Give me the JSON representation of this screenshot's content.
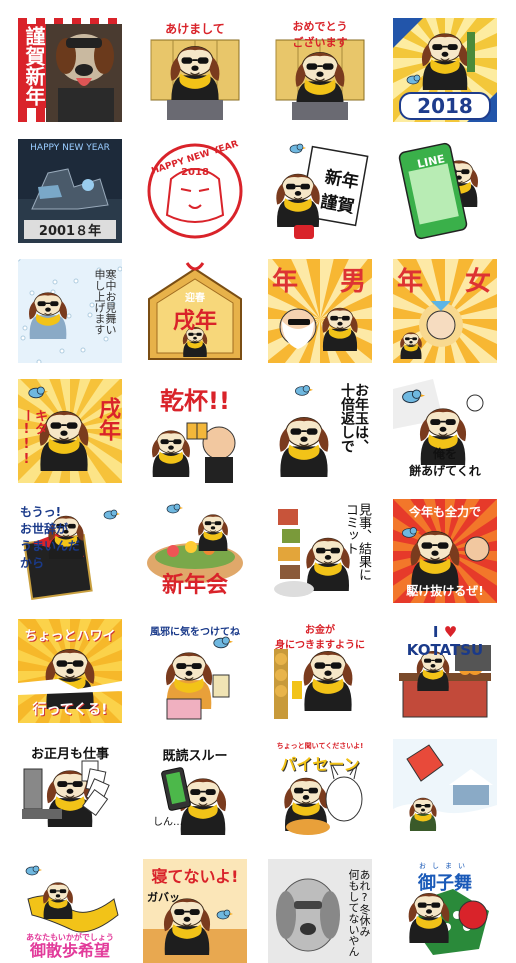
{
  "palette": {
    "fur_brown": "#7a3b1e",
    "fur_cream": "#f6e7c8",
    "ruff_yellow": "#f2c318",
    "suit_black": "#1e1e1e",
    "bird_blue": "#6fb8e0",
    "red": "#d9232a",
    "gold": "#f0b52c"
  },
  "stickers": [
    {
      "id": 1,
      "text": "謹賀新年",
      "icon": "realistic-dog-icon"
    },
    {
      "id": 2,
      "text": "あけまして",
      "icon": "dog-bowing-icon"
    },
    {
      "id": 3,
      "text": "おめでとう\nございます",
      "icon": "dog-bowing-icon"
    },
    {
      "id": 4,
      "text": "2018",
      "icon": "dog-with-kadomatsu-icon"
    },
    {
      "id": 5,
      "text": "HAPPY NEW YEAR",
      "text2": "2001８年",
      "icon": "robot-dog-icon"
    },
    {
      "id": 6,
      "text": "HAPPY NEW YEAR",
      "text2": "2018",
      "icon": "dog-stamp-icon"
    },
    {
      "id": 7,
      "text": "新年\n謹賀",
      "icon": "dog-holding-card-icon"
    },
    {
      "id": 8,
      "text": "LINE",
      "icon": "dog-holding-phone-icon"
    },
    {
      "id": 9,
      "text": "寒中お見舞い\n申し上げます",
      "icon": "dog-in-snow-icon"
    },
    {
      "id": 10,
      "text": "迎春",
      "text2": "戌年",
      "icon": "ema-plaque-icon"
    },
    {
      "id": 11,
      "text": "年",
      "text2": "男",
      "icon": "dog-and-oldman-icon"
    },
    {
      "id": 12,
      "text": "年",
      "text2": "女",
      "icon": "dog-and-girl-icon"
    },
    {
      "id": 13,
      "text": "キター!!!",
      "text2": "戌年",
      "icon": "dog-excited-icon"
    },
    {
      "id": 14,
      "text": "乾杯!!",
      "icon": "dog-toast-icon"
    },
    {
      "id": 15,
      "text": "お年玉は、\n十倍返しで",
      "icon": "dog-with-envelope-icon"
    },
    {
      "id": 16,
      "text": "俺を\n餅あげてくれ",
      "icon": "dog-mochi-icon"
    },
    {
      "id": 17,
      "text": "もうっ!\nお世辞が\nうまいんだから",
      "icon": "dog-osechi-icon"
    },
    {
      "id": 18,
      "text": "新年会",
      "icon": "dog-party-icon"
    },
    {
      "id": 19,
      "text": "見事、結果に\nコミット",
      "icon": "dog-feast-icon"
    },
    {
      "id": 20,
      "text": "今年も全力で",
      "text2": "駆け抜けるぜ!",
      "icon": "dog-running-icon"
    },
    {
      "id": 21,
      "text": "ちょっとハワイ",
      "text2": "行ってくる!",
      "icon": "dog-surfing-icon"
    },
    {
      "id": 22,
      "text": "風邪に気をつけてね",
      "icon": "dog-sick-icon"
    },
    {
      "id": 23,
      "text": "お金が\n身につきますように",
      "icon": "dog-praying-icon"
    },
    {
      "id": 24,
      "text": "I",
      "text2": "KOTATSU",
      "icon": "dog-kotatsu-icon"
    },
    {
      "id": 25,
      "text": "お正月も仕事",
      "icon": "dog-working-icon"
    },
    {
      "id": 26,
      "text": "既読スルー",
      "text2": "しん…",
      "icon": "dog-phone-icon"
    },
    {
      "id": 27,
      "text": "ちょっと聞いてくださいよ!",
      "text2": "パイセーン",
      "icon": "dog-and-senior-icon"
    },
    {
      "id": 28,
      "text": "",
      "icon": "kite-in-snow-icon"
    },
    {
      "id": 29,
      "text": "あなたもいかがでしょう",
      "text2": "御散歩希望",
      "icon": "dog-kung-fu-icon"
    },
    {
      "id": 30,
      "text": "寝てないよ!",
      "text2": "ガバッ",
      "icon": "dog-sleeping-icon"
    },
    {
      "id": 31,
      "text": "あれ?冬休み\n何もしてないやん",
      "icon": "dog-sketch-icon"
    },
    {
      "id": 32,
      "text": "御子舞",
      "text2": "おしまい",
      "icon": "lion-dance-icon"
    }
  ]
}
